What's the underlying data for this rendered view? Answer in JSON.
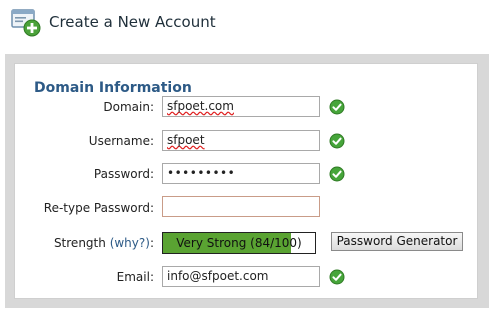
{
  "header": {
    "title": "Create a New Account",
    "icon": "new-account-icon"
  },
  "section": {
    "title": "Domain Information"
  },
  "form": {
    "domain": {
      "label": "Domain:",
      "value": "sfpoet.com",
      "status": "valid"
    },
    "username": {
      "label": "Username:",
      "value": "sfpoet",
      "status": "valid"
    },
    "password": {
      "label": "Password:",
      "value": "•••••••••",
      "status": "valid"
    },
    "retype_password": {
      "label": "Re-type Password:",
      "value": ""
    },
    "strength": {
      "label": "Strength",
      "why_link": "(why?)",
      "colon": ":",
      "text": "Very Strong (84/100)",
      "score": 84,
      "meter_fraction": 0.84,
      "fill_color": "#5aa332"
    },
    "generator_button": "Password Generator",
    "email": {
      "label": "Email:",
      "value": "info@sfpoet.com",
      "status": "valid"
    }
  },
  "colors": {
    "accent": "#2d5a86",
    "valid_green": "#46a53a",
    "panel_gray": "#d8d8d8"
  }
}
